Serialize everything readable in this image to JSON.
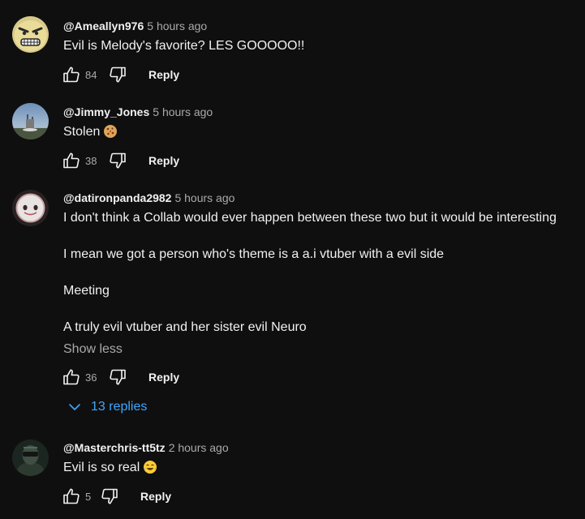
{
  "colors": {
    "background": "#0f0f0f",
    "text": "#f1f1f1",
    "muted": "#aaaaaa",
    "link": "#3ea6ff"
  },
  "comments": [
    {
      "author": "@Ameallyn976",
      "time": "5 hours ago",
      "lines": [
        "Evil is Melody's favorite? LES GOOOOO!!"
      ],
      "likes": "84",
      "reply_label": "Reply",
      "icons": [
        "thumb-up-icon",
        "thumb-down-icon"
      ]
    },
    {
      "author": "@Jimmy_Jones",
      "time": "5 hours ago",
      "lines": [
        "Stolen"
      ],
      "emoji": "cookie-icon",
      "likes": "38",
      "reply_label": "Reply"
    },
    {
      "author": "@datironpanda2982",
      "time": "5 hours ago",
      "lines": [
        "I don't think a Collab would ever happen between these two but it would be interesting",
        "I mean we got a person who's theme is a a.i vtuber with a evil side",
        "Meeting",
        "A truly evil vtuber and her sister evil Neuro"
      ],
      "show_less": "Show less",
      "likes": "36",
      "reply_label": "Reply",
      "replies_label": "13 replies"
    },
    {
      "author": "@Masterchris-tt5tz",
      "time": "2 hours ago",
      "lines": [
        "Evil is so real"
      ],
      "emoji": "laughing-face-icon",
      "likes": "5",
      "reply_label": "Reply"
    }
  ]
}
